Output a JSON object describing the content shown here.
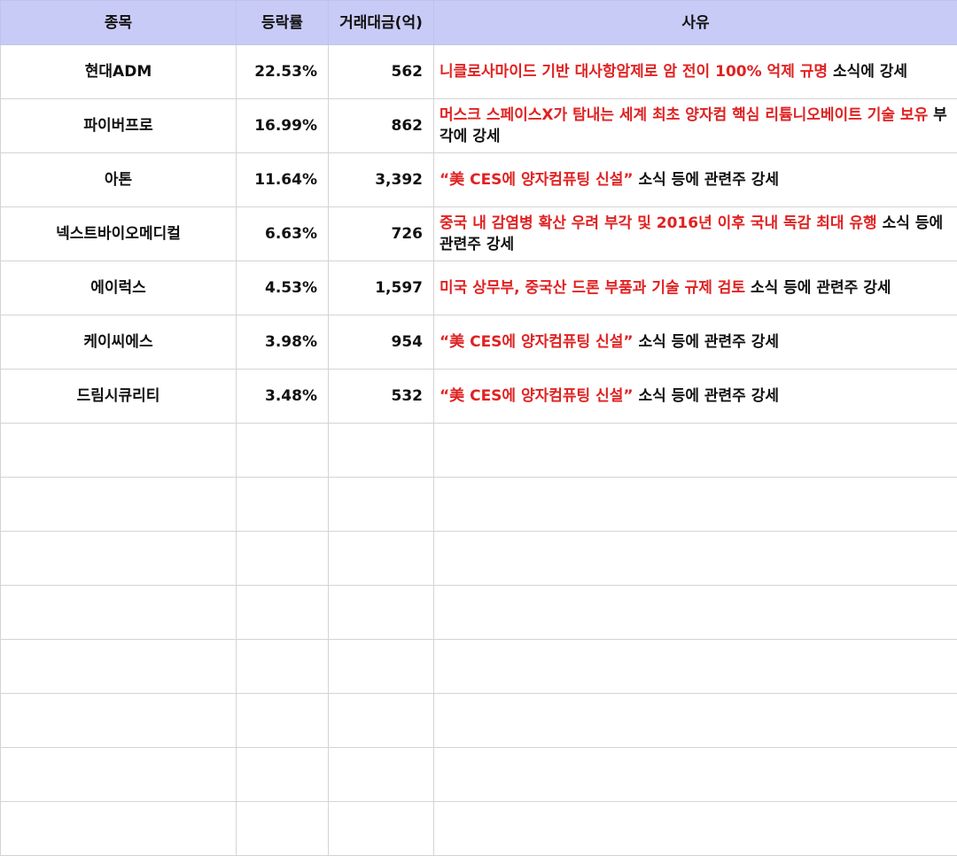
{
  "headers": {
    "name": "종목",
    "change": "등락률",
    "volume": "거래대금(억)",
    "reason": "사유"
  },
  "rows": [
    {
      "name": "현대ADM",
      "change": "22.53%",
      "volume": "562",
      "reason_red": "니클로사마이드 기반 대사항암제로 암 전이 100% 억제 규명",
      "reason_rest": " 소식에 강세"
    },
    {
      "name": "파이버프로",
      "change": "16.99%",
      "volume": "862",
      "reason_red": "머스크 스페이스X가 탐내는 세계 최초 양자컴 핵심 리튬니오베이트 기술 보유",
      "reason_rest": " 부각에 강세"
    },
    {
      "name": "아톤",
      "change": "11.64%",
      "volume": "3,392",
      "reason_red": "“美 CES에 양자컴퓨팅 신설”",
      "reason_rest": " 소식 등에 관련주 강세"
    },
    {
      "name": "넥스트바이오메디컬",
      "change": "6.63%",
      "volume": "726",
      "reason_red": "중국 내 감염병 확산 우려 부각 및 2016년 이후 국내 독감 최대 유행",
      "reason_rest": " 소식 등에  관련주 강세"
    },
    {
      "name": "에이럭스",
      "change": "4.53%",
      "volume": "1,597",
      "reason_red": "미국 상무부, 중국산 드론 부품과 기술 규제 검토",
      "reason_rest": " 소식 등에 관련주 강세"
    },
    {
      "name": "케이씨에스",
      "change": "3.98%",
      "volume": "954",
      "reason_red": "“美 CES에 양자컴퓨팅 신설”",
      "reason_rest": " 소식 등에 관련주 강세"
    },
    {
      "name": "드림시큐리티",
      "change": "3.48%",
      "volume": "532",
      "reason_red": "“美 CES에 양자컴퓨팅 신설”",
      "reason_rest": " 소식 등에 관련주 강세"
    }
  ],
  "colors": {
    "header_bg": "#c9cbf7",
    "highlight_text": "#e02222",
    "grid_line": "#d4d4d4"
  }
}
